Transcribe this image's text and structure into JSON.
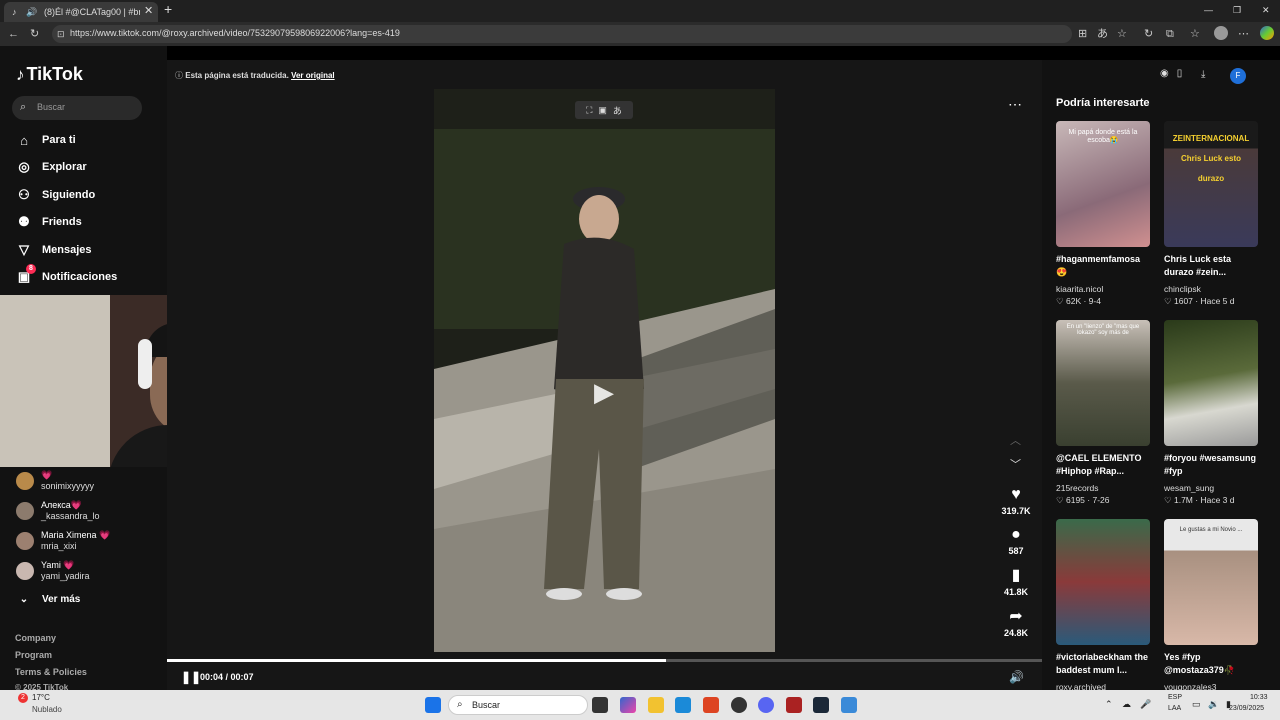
{
  "browser": {
    "tab_title": "(8)Él #@CLATag00 | #bradp",
    "url": "https://www.tiktok.com/@roxy.archived/video/7532907959806922006?lang=es-419"
  },
  "sidebar": {
    "logo": "TikTok",
    "search_placeholder": "Buscar",
    "nav": [
      {
        "label": "Para ti",
        "icon": "home-icon"
      },
      {
        "label": "Explorar",
        "icon": "compass-icon"
      },
      {
        "label": "Siguiendo",
        "icon": "following-icon"
      },
      {
        "label": "Friends",
        "icon": "friends-icon"
      },
      {
        "label": "Mensajes",
        "icon": "send-icon"
      },
      {
        "label": "Notificaciones",
        "icon": "inbox-icon"
      }
    ],
    "notification_badge": "8",
    "following": [
      {
        "name": "💗",
        "user": "sonimixyyyyy",
        "color": "#b98a4a"
      },
      {
        "name": "Алекса💗",
        "user": "_kassandra_lo",
        "color": "#8c7b6d"
      },
      {
        "name": "Maria Ximena 💗",
        "user": "mria_xixi",
        "color": "#9c8070"
      },
      {
        "name": "Yami 💗",
        "user": "yami_yadira",
        "color": "#c9b7b0"
      }
    ],
    "see_more": "Ver más",
    "footer": [
      "Company",
      "Program",
      "Terms & Policies",
      "© 2025 TikTok"
    ]
  },
  "video": {
    "translation_notice": "Esta página está traducida.",
    "translation_link": "Ver original",
    "likes": "319.7K",
    "comments": "587",
    "saves": "41.8K",
    "shares": "24.8K",
    "time": "00:04 / 00:07",
    "progress": 0.57
  },
  "recommendations": {
    "title": "Podría interesarte",
    "cards": [
      {
        "title": "#haganmemfamosa 😍",
        "user": "kiaarita.nicol",
        "likes": "62K",
        "date": "9-4",
        "overlay": "Mi papá donde está la escoba😭",
        "c1": "#9a7a7a",
        "c2": "#d8c8c8"
      },
      {
        "title": "Chris Luck esta durazo #zein...",
        "user": "chinclipsk",
        "likes": "1607",
        "date": "Hace 5 d",
        "overlay": "ZEINTERNACIONAL Chris Luck esto durazo",
        "c1": "#2a2a3a",
        "c2": "#5a4a4a"
      },
      {
        "title": "@CAEL ELEMENTO #Hiphop #Rap...",
        "user": "215records",
        "likes": "6195",
        "date": "7-26",
        "overlay": "En un \"lienzo\" de \"mas que lokazo\" soy más de",
        "c1": "#4a4f3a",
        "c2": "#8a8a7a"
      },
      {
        "title": "#foryou #wesamsung #fyp",
        "user": "wesam_sung",
        "likes": "1.7M",
        "date": "Hace 3 d",
        "overlay": "",
        "c1": "#3b4a2a",
        "c2": "#c8c8c8"
      },
      {
        "title": "#victoriabeckham the baddest mum I...",
        "user": "roxy.archived",
        "likes": "",
        "date": "",
        "overlay": "",
        "c1": "#2a5a3a",
        "c2": "#7a2a2a"
      },
      {
        "title": "Yes #fyp @mostaza379🥀",
        "user": "yougonzales3",
        "likes": "",
        "date": "",
        "overlay": "Le gustas a mi Novio ...",
        "c1": "#a09088",
        "c2": "#e8d8d0"
      }
    ]
  },
  "taskbar": {
    "weather_temp": "17°C",
    "weather_desc": "Nublado",
    "weather_badge": "2",
    "search": "Buscar",
    "lang1": "ESP",
    "lang2": "LAA",
    "time": "10:33",
    "date": "23/09/2025"
  }
}
